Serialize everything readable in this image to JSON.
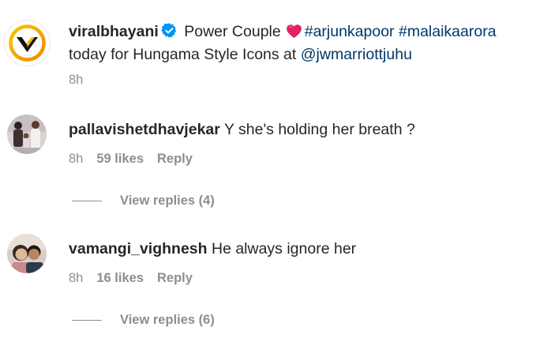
{
  "caption": {
    "username": "viralbhayani",
    "text_1": "Power Couple",
    "hashtag_1": "#arjunkapoor",
    "hashtag_2": "#malaikaarora",
    "text_2": "today for Hungama Style Icons at",
    "mention": "@jwmarriottjuhu",
    "time": "8h"
  },
  "comments": [
    {
      "username": "pallavishetdhavjekar",
      "text": "Y she's holding her breath ?",
      "time": "8h",
      "likes": "59 likes",
      "reply_label": "Reply",
      "view_replies": "View replies (4)"
    },
    {
      "username": "vamangi_vighnesh",
      "text": "He always ignore her",
      "time": "8h",
      "likes": "16 likes",
      "reply_label": "Reply",
      "view_replies": "View replies (6)"
    }
  ],
  "icons": {
    "verified": "verified-badge-icon",
    "heart": "red-heart-emoji-icon"
  },
  "colors": {
    "text": "#262626",
    "secondary": "#8e8e8e",
    "link": "#00376b",
    "verified": "#0095f6",
    "heart": "#e0245e"
  }
}
